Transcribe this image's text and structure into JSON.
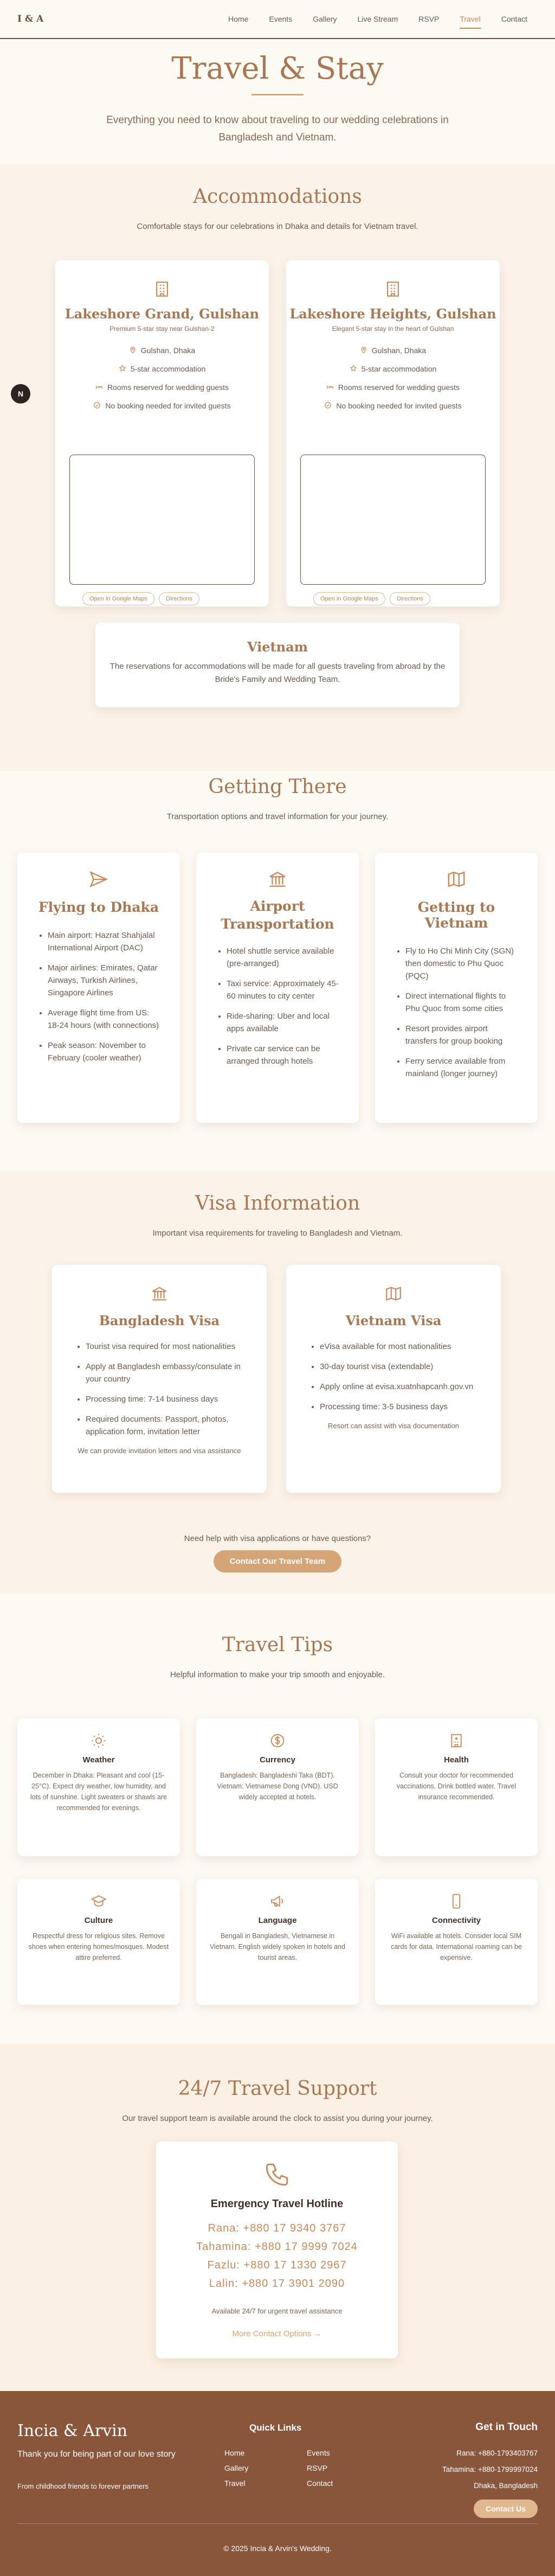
{
  "header": {
    "logo": "I & A",
    "nav": [
      "Home",
      "Events",
      "Gallery",
      "Live Stream",
      "RSVP",
      "Travel",
      "Contact"
    ],
    "active": "Travel"
  },
  "hero": {
    "title": "Travel & Stay",
    "subtitle": "Everything you need to know about traveling to our wedding celebrations in Bangladesh and Vietnam."
  },
  "accommodations": {
    "title": "Accommodations",
    "subtitle": "Comfortable stays for our celebrations in Dhaka and details for Vietnam travel.",
    "hotels": [
      {
        "name": "Lakeshore Grand, Gulshan",
        "tagline": "Premium 5-star stay near Gulshan-2",
        "location": "Gulshan, Dhaka",
        "rating": "5-star accommodation",
        "rooms": "Rooms reserved for wedding guests",
        "booking": "No booking needed for invited guests",
        "map_btn": "Open in Google Maps",
        "dir_btn": "Directions"
      },
      {
        "name": "Lakeshore Heights, Gulshan",
        "tagline": "Elegant 5-star stay in the heart of Gulshan",
        "location": "Gulshan, Dhaka",
        "rating": "5-star accommodation",
        "rooms": "Rooms reserved for wedding guests",
        "booking": "No booking needed for invited guests",
        "map_btn": "Open in Google Maps",
        "dir_btn": "Directions"
      }
    ],
    "vietnam": {
      "title": "Vietnam",
      "text": "The reservations for accommodations will be made for all guests traveling from abroad by the Bride's Family and Wedding Team."
    }
  },
  "getting_there": {
    "title": "Getting There",
    "subtitle": "Transportation options and travel information for your journey.",
    "cards": [
      {
        "title": "Flying to Dhaka",
        "items": [
          "Main airport: Hazrat Shahjalal International Airport (DAC)",
          "Major airlines: Emirates, Qatar Airways, Turkish Airlines, Singapore Airlines",
          "Average flight time from US: 18-24 hours (with connections)",
          "Peak season: November to February (cooler weather)"
        ]
      },
      {
        "title": "Airport Transportation",
        "items": [
          "Hotel shuttle service available (pre-arranged)",
          "Taxi service: Approximately 45-60 minutes to city center",
          "Ride-sharing: Uber and local apps available",
          "Private car service can be arranged through hotels"
        ]
      },
      {
        "title": "Getting to Vietnam",
        "items": [
          "Fly to Ho Chi Minh City (SGN) then domestic to Phu Quoc (PQC)",
          "Direct international flights to Phu Quoc from some cities",
          "Resort provides airport transfers for group booking",
          "Ferry service available from mainland (longer journey)"
        ]
      }
    ]
  },
  "visa": {
    "title": "Visa Information",
    "subtitle": "Important visa requirements for traveling to Bangladesh and Vietnam.",
    "cards": [
      {
        "title": "Bangladesh Visa",
        "items": [
          "Tourist visa required for most nationalities",
          "Apply at Bangladesh embassy/consulate in your country",
          "Processing time: 7-14 business days",
          "Required documents: Passport, photos, application form, invitation letter"
        ],
        "note": "We can provide invitation letters and visa assistance"
      },
      {
        "title": "Vietnam Visa",
        "items": [
          "eVisa available for most nationalities",
          "30-day tourist visa (extendable)",
          "Apply online at evisa.xuatnhapcanh.gov.vn",
          "Processing time: 3-5 business days"
        ],
        "note": "Resort can assist with visa documentation"
      }
    ],
    "help_text": "Need help with visa applications or have questions?",
    "help_btn": "Contact Our Travel Team"
  },
  "tips": {
    "title": "Travel Tips",
    "subtitle": "Helpful information to make your trip smooth and enjoyable.",
    "cards": [
      {
        "icon": "sun-icon",
        "title": "Weather",
        "text": "December in Dhaka: Pleasant and cool (15-25°C). Expect dry weather, low humidity, and lots of sunshine. Light sweaters or shawls are recommended for evenings."
      },
      {
        "icon": "dollar-icon",
        "title": "Currency",
        "text": "Bangladesh: Bangladeshi Taka (BDT). Vietnam: Vietnamese Dong (VND). USD widely accepted at hotels."
      },
      {
        "icon": "hospital-icon",
        "title": "Health",
        "text": "Consult your doctor for recommended vaccinations. Drink bottled water. Travel insurance recommended."
      },
      {
        "icon": "graduation-cap-icon",
        "title": "Culture",
        "text": "Respectful dress for religious sites. Remove shoes when entering homes/mosques. Modest attire preferred."
      },
      {
        "icon": "megaphone-icon",
        "title": "Language",
        "text": "Bengali in Bangladesh, Vietnamese in Vietnam. English widely spoken in hotels and tourist areas."
      },
      {
        "icon": "smartphone-icon",
        "title": "Connectivity",
        "text": "WiFi available at hotels. Consider local SIM cards for data. International roaming can be expensive."
      }
    ]
  },
  "support": {
    "title": "24/7 Travel Support",
    "subtitle": "Our travel support team is available around the clock to assist you during your journey.",
    "hotline_title": "Emergency Travel Hotline",
    "contacts": [
      "Rana: +880 17 9340 3767",
      "Tahamina: +880 17 9999 7024",
      "Fazlu: +880 17 1330 2967",
      "Lalin: +880 17 3901 2090"
    ],
    "note": "Available 24/7 for urgent travel assistance",
    "more": "More Contact Options →"
  },
  "footer": {
    "names": "Incia & Arvin",
    "thanks": "Thank you for being part of our love story",
    "tagline": "From childhood friends to forever partners",
    "quick_title": "Quick Links",
    "links_left": [
      "Home",
      "Gallery",
      "Travel"
    ],
    "links_right": [
      "Events",
      "RSVP",
      "Contact"
    ],
    "touch_title": "Get in Touch",
    "touch_lines": [
      "Rana: +880-1793403767",
      "Tahamina: +880-1799997024",
      "Dhaka, Bangladesh"
    ],
    "contact_btn": "Contact Us",
    "copyright": "© 2025 Incia & Arvin's Wedding."
  },
  "colors": {
    "accent": "#a97852",
    "button": "#d6a577",
    "footer": "#8a563b",
    "background": "#fdf9f3"
  }
}
